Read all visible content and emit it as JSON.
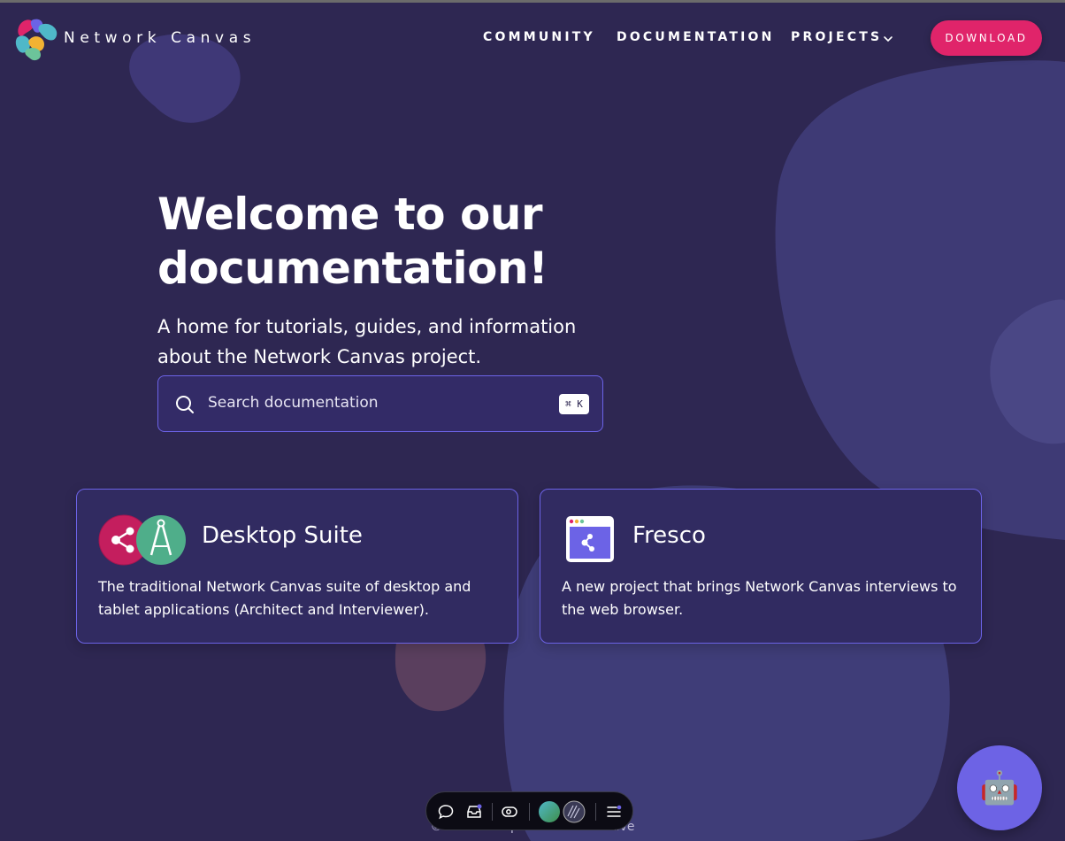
{
  "header": {
    "brand": "Network Canvas",
    "nav": {
      "community": "COMMUNITY",
      "documentation": "DOCUMENTATION",
      "projects": "PROJECTS"
    },
    "download_label": "DOWNLOAD"
  },
  "hero": {
    "title": "Welcome to our documentation!",
    "subtitle": "A home for tutorials, guides, and information about the Network Canvas project.",
    "search": {
      "placeholder": "Search documentation",
      "shortcut": "⌘ K"
    }
  },
  "cards": [
    {
      "title": "Desktop Suite",
      "description": "The traditional Network Canvas suite of desktop and tablet applications (Architect and Interviewer)."
    },
    {
      "title": "Fresco",
      "description": "A new project that brings Network Canvas interviews to the web browser."
    }
  ],
  "footer": {
    "copyright": "© 2024 Complex Data Collective"
  },
  "toolbar": {
    "icons": [
      "comment-icon",
      "inbox-icon",
      "eye-icon",
      "avatar",
      "avatar",
      "menu-icon"
    ]
  },
  "chatbot": {
    "icon": "🤖"
  },
  "colors": {
    "background": "#2e2752",
    "accent": "#6c63e6",
    "download": "#e0246a",
    "card": "#312b61"
  }
}
